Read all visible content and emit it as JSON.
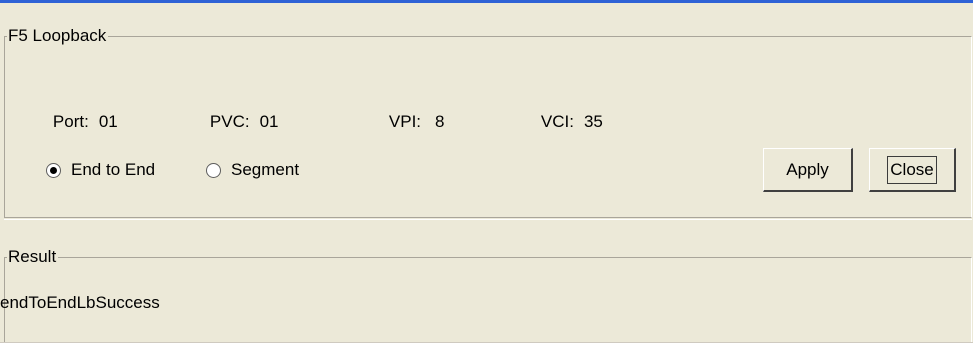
{
  "f5_group": {
    "title": "F5 Loopback",
    "port": {
      "label": "Port:",
      "value": "01"
    },
    "pvc": {
      "label": "PVC:",
      "value": "01"
    },
    "vpi": {
      "label": "VPI:",
      "value": "8"
    },
    "vci": {
      "label": "VCI:",
      "value": "35"
    },
    "radio_end_to_end": {
      "label": "End to End",
      "checked": true
    },
    "radio_segment": {
      "label": "Segment",
      "checked": false
    },
    "apply_label": "Apply",
    "close_label": "Close"
  },
  "result_group": {
    "title": "Result",
    "text": "endToEndLbSuccess"
  },
  "colors": {
    "window_bg": "#ece9d8",
    "title_accent": "#2f62d6"
  }
}
